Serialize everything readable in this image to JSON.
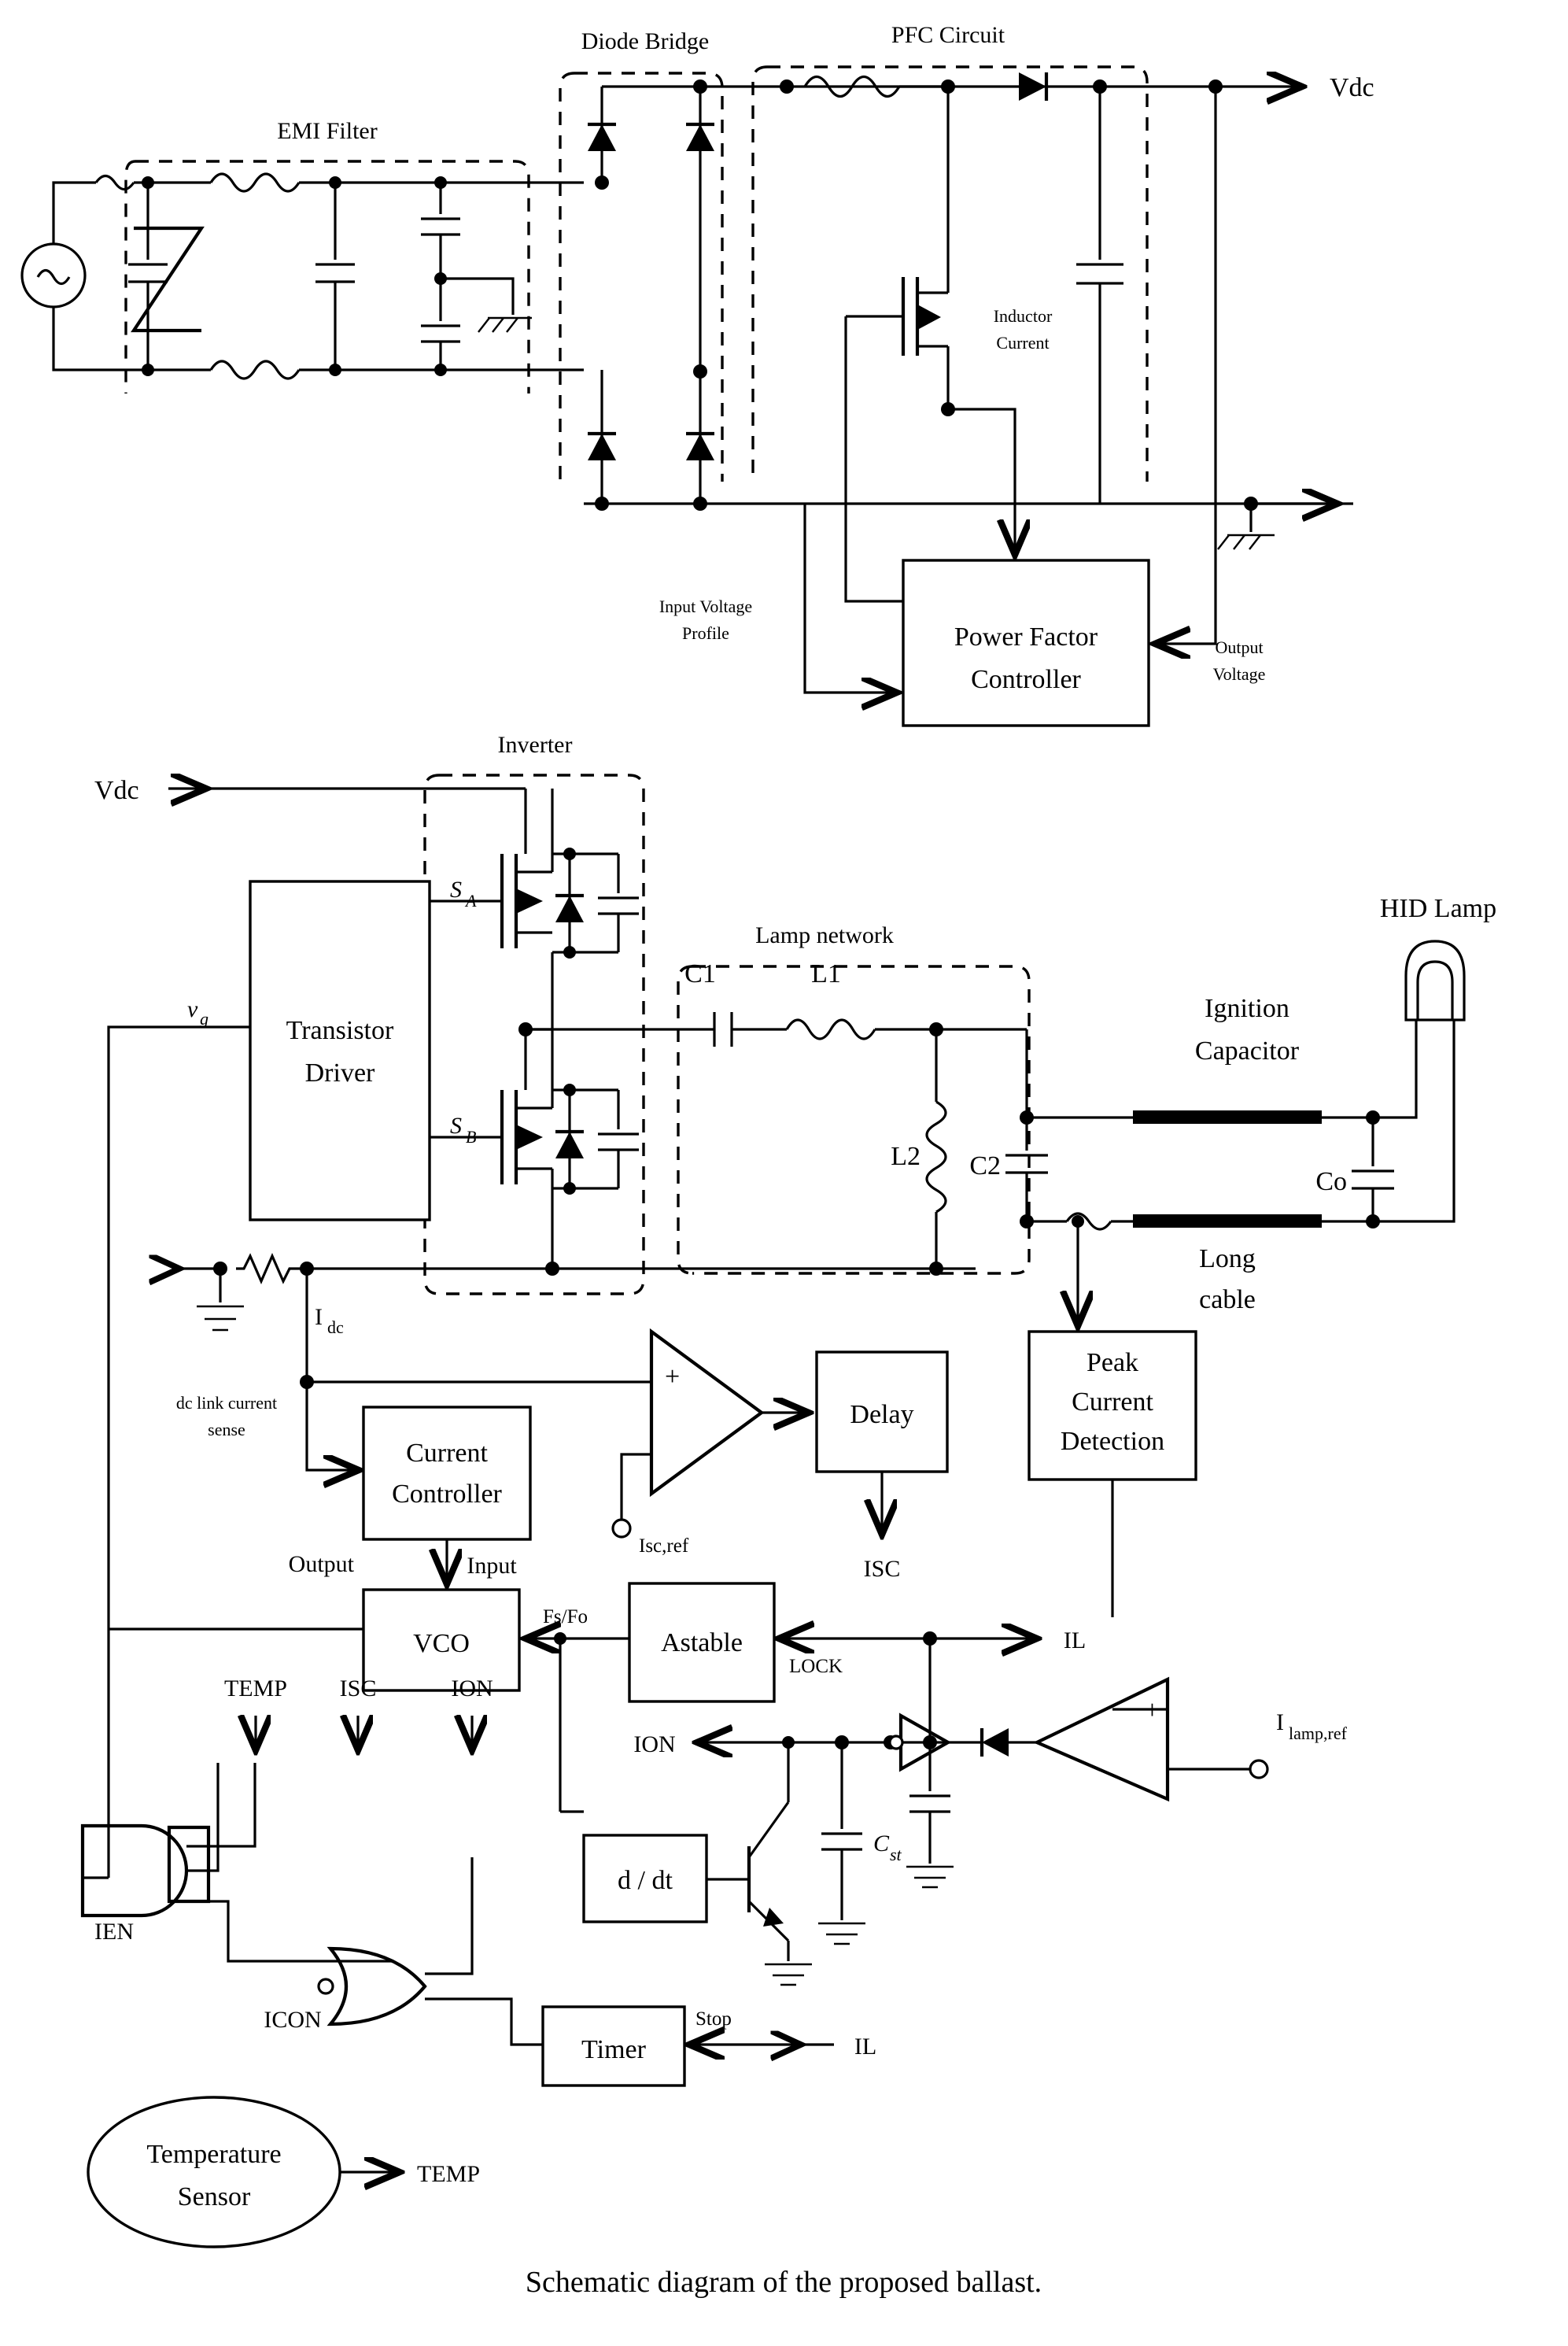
{
  "figure": {
    "caption": "Schematic diagram of the proposed ballast.",
    "type": "circuit-schematic"
  },
  "stage1": {
    "group_labels": {
      "emi_filter": "EMI Filter",
      "diode_bridge": "Diode Bridge",
      "pfc_circuit": "PFC Circuit"
    },
    "signal_labels": {
      "vdc_out": "Vdc",
      "inductor_current": "Inductor\nCurrent",
      "inductor_current_line1": "Inductor",
      "inductor_current_line2": "Current",
      "input_voltage_profile_line1": "Input Voltage",
      "input_voltage_profile_line2": "Profile",
      "output_voltage_line1": "Output",
      "output_voltage_line2": "Voltage"
    },
    "blocks": {
      "power_factor_controller_line1": "Power Factor",
      "power_factor_controller_line2": "Controller"
    }
  },
  "stage2": {
    "group_labels": {
      "inverter": "Inverter",
      "lamp_network": "Lamp network"
    },
    "signal_labels": {
      "vdc_in": "Vdc",
      "v_g": "v",
      "v_g_sub": "g",
      "switch_a": "S",
      "switch_a_sub": "A",
      "switch_b": "S",
      "switch_b_sub": "B",
      "c1": "C1",
      "l1": "L1",
      "l2": "L2",
      "c2": "C2",
      "co": "Co",
      "ignition_capacitor_line1": "Ignition",
      "ignition_capacitor_line2": "Capacitor",
      "hid_lamp": "HID Lamp",
      "long_cable_line1": "Long",
      "long_cable_line2": "cable",
      "i_dc": "I",
      "i_dc_sub": "dc",
      "dc_link_sense_line1": "dc link current",
      "dc_link_sense_line2": "sense"
    },
    "blocks": {
      "transistor_driver_line1": "Transistor",
      "transistor_driver_line2": "Driver"
    }
  },
  "control": {
    "blocks": {
      "current_controller_line1": "Current",
      "current_controller_line2": "Controller",
      "delay": "Delay",
      "peak_current_detection_line1": "Peak",
      "peak_current_detection_line2": "Current",
      "peak_current_detection_line3": "Detection",
      "vco": "VCO",
      "astable": "Astable",
      "ddt": "d / dt",
      "timer": "Timer",
      "temperature_sensor_line1": "Temperature",
      "temperature_sensor_line2": "Sensor"
    },
    "signal_labels": {
      "isc_ref": "Isc,ref",
      "isc": "ISC",
      "input": "Input",
      "output": "Output",
      "fs_fo": "Fs/Fo",
      "lock": "LOCK",
      "il_right": "IL",
      "il_timer": "IL",
      "ion_mid": "ION",
      "ion_gate": "ION",
      "icon": "ICON",
      "ien": "IEN",
      "temp_gate": "TEMP",
      "isc_gate": "ISC",
      "temp_sensor_out": "TEMP",
      "stop": "Stop",
      "c_st": "C",
      "c_st_sub": "st",
      "i_lamp_ref": "I",
      "i_lamp_ref_sub": "lamp,ref",
      "opamp_plus_1": "+",
      "opamp_plus_2": "+"
    }
  },
  "colors": {
    "ink": "#000000",
    "paper": "#ffffff"
  }
}
